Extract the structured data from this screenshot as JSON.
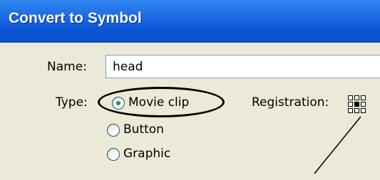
{
  "window": {
    "title": "Convert to Symbol"
  },
  "form": {
    "name_label": "Name:",
    "name_value": "head",
    "type_label": "Type:",
    "registration_label": "Registration:",
    "type_options": [
      {
        "label": "Movie clip",
        "selected": true
      },
      {
        "label": "Button",
        "selected": false
      },
      {
        "label": "Graphic",
        "selected": false
      }
    ],
    "registration_selected": "center"
  },
  "colors": {
    "title_bar": "#0a55d6",
    "dialog_bg": "#ece9d8",
    "radio_dot": "#21a121"
  }
}
